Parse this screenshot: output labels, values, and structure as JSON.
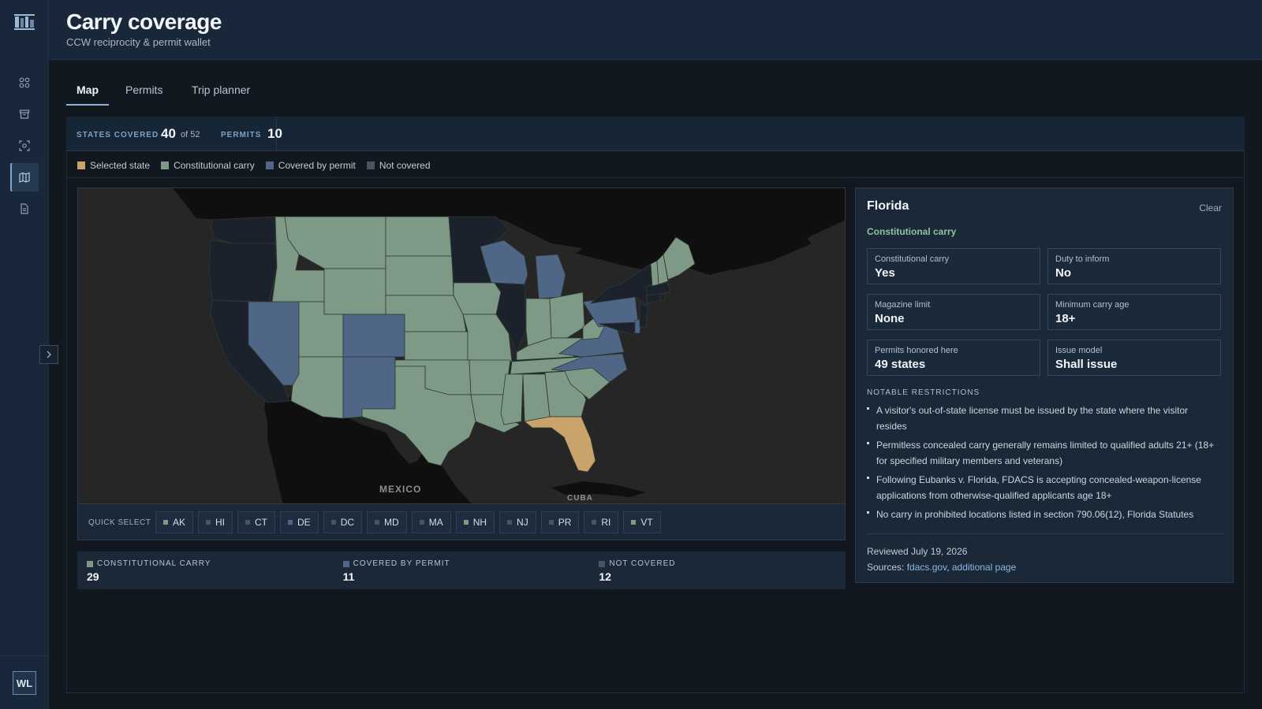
{
  "header": {
    "title": "Carry coverage",
    "subtitle": "CCW reciprocity & permit wallet"
  },
  "tabs": [
    {
      "label": "Map",
      "active": true
    },
    {
      "label": "Permits"
    },
    {
      "label": "Trip planner"
    }
  ],
  "stats": {
    "states_label": "STATES COVERED",
    "states_value": "40",
    "states_total": "of 52",
    "permits_label": "PERMITS",
    "permits_value": "10"
  },
  "legend": [
    {
      "label": "Selected state",
      "color": "#c9a36a"
    },
    {
      "label": "Constitutional carry",
      "color": "#7e9a86"
    },
    {
      "label": "Covered by permit",
      "color": "#4f6686"
    },
    {
      "label": "Not covered",
      "color": "#4a5362"
    }
  ],
  "map": {
    "labels": {
      "mexico": "MEXICO",
      "cuba": "CUBA"
    },
    "colors": {
      "selected": "#c9a36a",
      "constitutional": "#7e9a86",
      "permit": "#4f6686",
      "not_covered": "#1c222c",
      "land": "#0c0c0c",
      "water": "#262626"
    }
  },
  "quick_select": {
    "label": "QUICK SELECT",
    "chips": [
      {
        "code": "AK",
        "status": "constitutional"
      },
      {
        "code": "HI",
        "status": "not_covered"
      },
      {
        "code": "CT",
        "status": "not_covered"
      },
      {
        "code": "DE",
        "status": "permit"
      },
      {
        "code": "DC",
        "status": "not_covered"
      },
      {
        "code": "MD",
        "status": "not_covered"
      },
      {
        "code": "MA",
        "status": "not_covered"
      },
      {
        "code": "NH",
        "status": "constitutional"
      },
      {
        "code": "NJ",
        "status": "not_covered"
      },
      {
        "code": "PR",
        "status": "not_covered"
      },
      {
        "code": "RI",
        "status": "not_covered"
      },
      {
        "code": "VT",
        "status": "constitutional"
      }
    ]
  },
  "summary": [
    {
      "label": "CONSTITUTIONAL CARRY",
      "value": "29",
      "color": "#7e9a86"
    },
    {
      "label": "COVERED BY PERMIT",
      "value": "11",
      "color": "#4f6686"
    },
    {
      "label": "NOT COVERED",
      "value": "12",
      "color": "#4a5362"
    }
  ],
  "detail": {
    "title": "Florida",
    "clear": "Clear",
    "status": "Constitutional carry",
    "facts": [
      {
        "label": "Constitutional carry",
        "value": "Yes"
      },
      {
        "label": "Duty to inform",
        "value": "No"
      },
      {
        "label": "Magazine limit",
        "value": "None"
      },
      {
        "label": "Minimum carry age",
        "value": "18+"
      },
      {
        "label": "Permits honored here",
        "value": "49 states"
      },
      {
        "label": "Issue model",
        "value": "Shall issue"
      }
    ],
    "restrictions_label": "NOTABLE RESTRICTIONS",
    "restrictions": [
      "A visitor's out-of-state license must be issued by the state where the visitor resides",
      "Permitless concealed carry generally remains limited to qualified adults 21+ (18+ for specified military members and veterans)",
      "Following Eubanks v. Florida, FDACS is accepting concealed-weapon-license applications from otherwise-qualified applicants age 18+",
      "No carry in prohibited locations listed in section 790.06(12), Florida Statutes"
    ],
    "reviewed": "Reviewed July 19, 2026",
    "sources_label": "Sources:",
    "source_1": "fdacs.gov",
    "source_sep": ",",
    "source_2": "additional page"
  },
  "user": {
    "initials": "WL"
  }
}
